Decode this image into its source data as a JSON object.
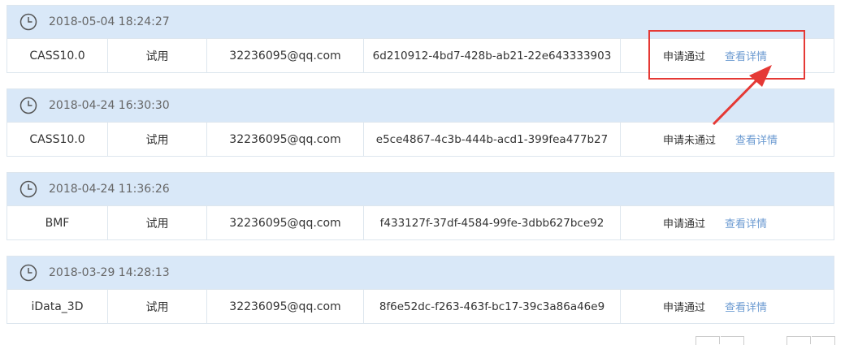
{
  "records": [
    {
      "time": "2018-05-04 18:24:27",
      "product": "CASS10.0",
      "type": "试用",
      "email": "32236095@qq.com",
      "key": "6d210912-4bd7-428b-ab21-22e643333903",
      "status": "申请通过",
      "detail_label": "查看详情"
    },
    {
      "time": "2018-04-24 16:30:30",
      "product": "CASS10.0",
      "type": "试用",
      "email": "32236095@qq.com",
      "key": "e5ce4867-4c3b-444b-acd1-399fea477b27",
      "status": "申请未通过",
      "detail_label": "查看详情"
    },
    {
      "time": "2018-04-24 11:36:26",
      "product": "BMF",
      "type": "试用",
      "email": "32236095@qq.com",
      "key": "f433127f-37df-4584-99fe-3dbb627bce92",
      "status": "申请通过",
      "detail_label": "查看详情"
    },
    {
      "time": "2018-03-29 14:28:13",
      "product": "iData_3D",
      "type": "试用",
      "email": "32236095@qq.com",
      "key": "8f6e52dc-f263-463f-bc17-39c3a86a46e9",
      "status": "申请通过",
      "detail_label": "查看详情"
    }
  ],
  "icons": {
    "record_time": "clock-icon"
  },
  "colors": {
    "header_bg": "#d9e8f8",
    "link": "#6b9ad1",
    "annotation": "#e53935"
  }
}
